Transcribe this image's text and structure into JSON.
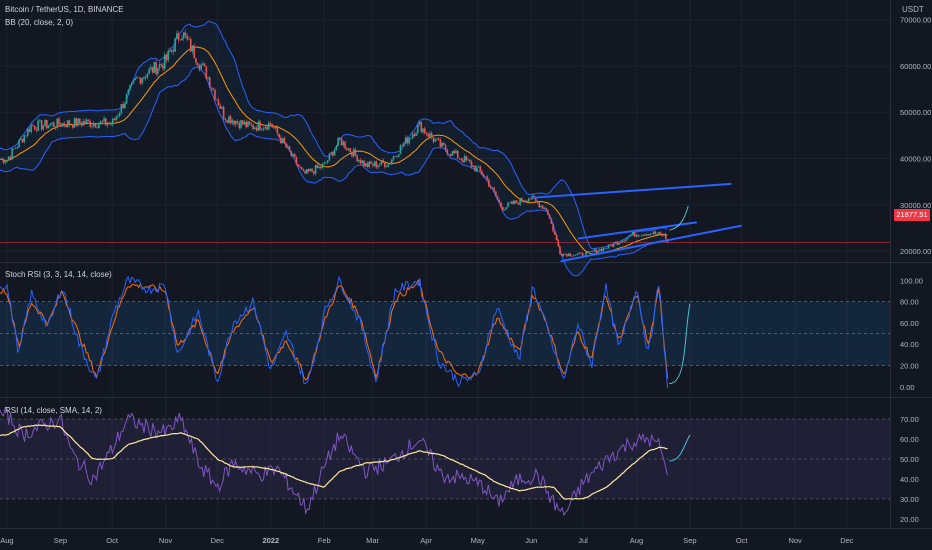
{
  "header": {
    "symbol_line": "Bitcoin / TetherUS, 1D, BINANCE",
    "indicator_line": "BB (20, close, 2, 0)",
    "currency": "USDT",
    "last_price": "21877.51"
  },
  "panes": {
    "stoch_title": "Stoch RSI (3, 3, 14, 14, close)",
    "rsi_title": "RSI (14, close, SMA, 14, 2)"
  },
  "colors": {
    "background": "#131722",
    "up": "#26a69a",
    "down": "#ef5350",
    "bb_band": "#2962ff",
    "bb_basis": "#ff9800",
    "trendline": "#2962ff",
    "forecast": "#4dd0e1",
    "stoch_k": "#2962ff",
    "stoch_d": "#ff6d00",
    "rsi_line": "#7e57c2",
    "rsi_ma": "#ffeb9c",
    "price_line": "#f23645"
  },
  "chart_data": [
    {
      "type": "candlestick",
      "title": "Bitcoin / TetherUS, 1D, BINANCE",
      "ylabel": "USDT",
      "y_ticks": [
        20000,
        30000,
        40000,
        50000,
        60000,
        70000
      ],
      "y_tick_labels": [
        "20000.00",
        "30000.00",
        "40000.00",
        "50000.00",
        "60000.00",
        "70000.00"
      ],
      "ylim": [
        18500,
        72500
      ],
      "last_price": 21877.51,
      "x_labels": [
        "Aug",
        "Sep",
        "Oct",
        "Nov",
        "Dec",
        "2022",
        "Feb",
        "Mar",
        "Apr",
        "May",
        "Jun",
        "Jul",
        "Aug",
        "Sep",
        "Oct",
        "Nov",
        "Dec"
      ],
      "close_series_estimate": {
        "x": [
          "2021-08-01",
          "2021-08-15",
          "2021-09-01",
          "2021-09-15",
          "2021-10-01",
          "2021-10-15",
          "2021-11-01",
          "2021-11-10",
          "2021-11-25",
          "2021-12-05",
          "2021-12-20",
          "2022-01-01",
          "2022-01-20",
          "2022-02-01",
          "2022-02-10",
          "2022-02-25",
          "2022-03-10",
          "2022-03-28",
          "2022-04-10",
          "2022-04-25",
          "2022-05-05",
          "2022-05-15",
          "2022-05-31",
          "2022-06-10",
          "2022-06-18",
          "2022-07-01",
          "2022-07-15",
          "2022-07-30",
          "2022-08-10",
          "2022-08-17",
          "2022-08-19"
        ],
        "close": [
          39800,
          47000,
          47500,
          47800,
          47500,
          57000,
          61000,
          67500,
          58000,
          49200,
          46800,
          47500,
          36500,
          38500,
          44000,
          38500,
          39000,
          47200,
          42500,
          39300,
          36300,
          29300,
          31600,
          29000,
          19400,
          19200,
          20800,
          23600,
          23900,
          23400,
          21877.51
        ]
      },
      "bollinger_bands": {
        "period": 20,
        "stddev": 2,
        "series": [
          "upper",
          "basis",
          "lower"
        ]
      },
      "annotations": [
        {
          "type": "trendline",
          "from": [
            "2022-06-01",
            31500
          ],
          "to": [
            "2022-09-25",
            34500
          ]
        },
        {
          "type": "trendline",
          "from": [
            "2022-06-28",
            22700
          ],
          "to": [
            "2022-09-05",
            26200
          ]
        },
        {
          "type": "trendline",
          "from": [
            "2022-06-18",
            17800
          ],
          "to": [
            "2022-10-01",
            25500
          ]
        },
        {
          "type": "forecast-arrow",
          "from": [
            "2022-08-20",
            24500
          ],
          "to": [
            "2022-08-31",
            29700
          ]
        }
      ]
    },
    {
      "type": "line",
      "title": "Stoch RSI (3, 3, 14, 14, close)",
      "y_ticks": [
        0,
        20,
        40,
        60,
        80,
        100
      ],
      "y_tick_labels": [
        "0.00",
        "20.00",
        "40.00",
        "60.00",
        "80.00",
        "100.00"
      ],
      "ylim": [
        -3,
        106
      ],
      "bands": [
        20,
        50,
        80
      ],
      "series": [
        {
          "key": "k",
          "x": [
            "2021-08-01",
            "2021-08-08",
            "2021-08-15",
            "2021-08-25",
            "2021-09-02",
            "2021-09-12",
            "2021-09-22",
            "2021-10-02",
            "2021-10-10",
            "2021-10-22",
            "2021-11-01",
            "2021-11-08",
            "2021-11-20",
            "2021-12-01",
            "2021-12-10",
            "2021-12-22",
            "2022-01-01",
            "2022-01-10",
            "2022-01-22",
            "2022-02-02",
            "2022-02-10",
            "2022-02-22",
            "2022-03-03",
            "2022-03-14",
            "2022-03-28",
            "2022-04-08",
            "2022-04-20",
            "2022-05-01",
            "2022-05-12",
            "2022-05-25",
            "2022-06-02",
            "2022-06-10",
            "2022-06-20",
            "2022-06-28",
            "2022-07-06",
            "2022-07-14",
            "2022-07-22",
            "2022-08-01",
            "2022-08-08",
            "2022-08-14",
            "2022-08-19"
          ],
          "y": [
            95,
            30,
            88,
            55,
            95,
            40,
            5,
            70,
            100,
            92,
            95,
            30,
            70,
            5,
            60,
            80,
            15,
            50,
            0,
            75,
            100,
            60,
            5,
            90,
            100,
            25,
            5,
            10,
            75,
            25,
            95,
            55,
            5,
            60,
            20,
            95,
            35,
            95,
            30,
            98,
            2
          ]
        },
        {
          "key": "d",
          "x": [
            "2021-08-01",
            "2021-08-08",
            "2021-08-15",
            "2021-08-25",
            "2021-09-02",
            "2021-09-12",
            "2021-09-22",
            "2021-10-02",
            "2021-10-10",
            "2021-10-22",
            "2021-11-01",
            "2021-11-08",
            "2021-11-20",
            "2021-12-01",
            "2021-12-10",
            "2021-12-22",
            "2022-01-01",
            "2022-01-10",
            "2022-01-22",
            "2022-02-02",
            "2022-02-10",
            "2022-02-22",
            "2022-03-03",
            "2022-03-14",
            "2022-03-28",
            "2022-04-08",
            "2022-04-20",
            "2022-05-01",
            "2022-05-12",
            "2022-05-25",
            "2022-06-02",
            "2022-06-10",
            "2022-06-20",
            "2022-06-28",
            "2022-07-06",
            "2022-07-14",
            "2022-07-22",
            "2022-08-01",
            "2022-08-08",
            "2022-08-14",
            "2022-08-19"
          ],
          "y": [
            90,
            38,
            80,
            60,
            90,
            48,
            10,
            62,
            96,
            94,
            90,
            38,
            62,
            12,
            52,
            76,
            22,
            44,
            6,
            66,
            96,
            66,
            10,
            82,
            98,
            34,
            10,
            12,
            66,
            32,
            88,
            60,
            10,
            52,
            26,
            88,
            42,
            88,
            38,
            92,
            10
          ]
        }
      ],
      "annotations": [
        {
          "type": "forecast-arrow",
          "from": [
            "2022-08-20",
            3
          ],
          "to": [
            "2022-09-01",
            78
          ]
        }
      ]
    },
    {
      "type": "line",
      "title": "RSI (14, close, SMA, 14, 2)",
      "y_ticks": [
        20,
        30,
        40,
        50,
        60,
        70
      ],
      "y_tick_labels": [
        "20.00",
        "30.00",
        "40.00",
        "50.00",
        "60.00",
        "70.00"
      ],
      "ylim": [
        17,
        77
      ],
      "bands": [
        30,
        50,
        70
      ],
      "series": [
        {
          "key": "rsi",
          "x": [
            "2021-08-01",
            "2021-08-10",
            "2021-08-20",
            "2021-09-01",
            "2021-09-08",
            "2021-09-20",
            "2021-10-01",
            "2021-10-10",
            "2021-10-20",
            "2021-11-01",
            "2021-11-10",
            "2021-11-20",
            "2021-12-01",
            "2021-12-10",
            "2021-12-25",
            "2022-01-05",
            "2022-01-22",
            "2022-02-01",
            "2022-02-10",
            "2022-02-25",
            "2022-03-10",
            "2022-03-28",
            "2022-04-10",
            "2022-04-25",
            "2022-05-05",
            "2022-05-12",
            "2022-05-25",
            "2022-06-05",
            "2022-06-14",
            "2022-06-20",
            "2022-07-01",
            "2022-07-15",
            "2022-07-28",
            "2022-08-08",
            "2022-08-15",
            "2022-08-19"
          ],
          "y": [
            72,
            62,
            66,
            70,
            52,
            40,
            55,
            70,
            66,
            63,
            70,
            48,
            36,
            48,
            42,
            45,
            25,
            46,
            62,
            44,
            48,
            60,
            42,
            40,
            36,
            28,
            40,
            42,
            28,
            22,
            38,
            50,
            58,
            60,
            56,
            40
          ]
        },
        {
          "key": "ma",
          "x": [
            "2021-08-01",
            "2021-08-10",
            "2021-08-20",
            "2021-09-01",
            "2021-09-08",
            "2021-09-20",
            "2021-10-01",
            "2021-10-10",
            "2021-10-20",
            "2021-11-01",
            "2021-11-10",
            "2021-11-20",
            "2021-12-01",
            "2021-12-10",
            "2021-12-25",
            "2022-01-05",
            "2022-01-22",
            "2022-02-01",
            "2022-02-10",
            "2022-02-25",
            "2022-03-10",
            "2022-03-28",
            "2022-04-10",
            "2022-04-25",
            "2022-05-05",
            "2022-05-12",
            "2022-05-25",
            "2022-06-05",
            "2022-06-14",
            "2022-06-20",
            "2022-07-01",
            "2022-07-15",
            "2022-07-28",
            "2022-08-08",
            "2022-08-15",
            "2022-08-19"
          ],
          "y": [
            62,
            66,
            67,
            66,
            60,
            50,
            50,
            57,
            60,
            62,
            63,
            60,
            50,
            46,
            46,
            44,
            38,
            36,
            44,
            48,
            49,
            54,
            52,
            46,
            42,
            38,
            34,
            36,
            36,
            30,
            30,
            36,
            46,
            54,
            56,
            55
          ]
        }
      ],
      "annotations": [
        {
          "type": "forecast-arrow",
          "from": [
            "2022-08-20",
            49
          ],
          "to": [
            "2022-09-01",
            62
          ]
        }
      ]
    }
  ]
}
